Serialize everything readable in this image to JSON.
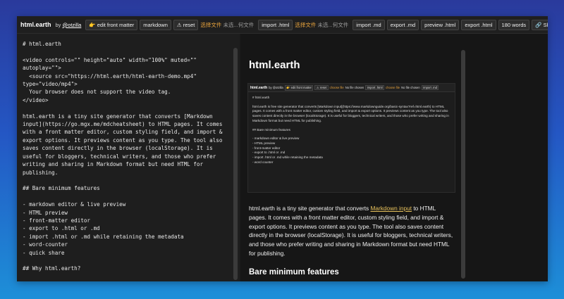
{
  "toolbar": {
    "brand": "html.earth",
    "by_prefix": "by",
    "by_user": "@otzilla",
    "edit_front_matter": "👉 edit front matter",
    "markdown": "markdown",
    "reset": "⚠ reset",
    "file1_btn": "选择文件",
    "file1_status": "未选...何文件",
    "import_html": "import .html",
    "file2_btn": "选择文件",
    "file2_status": "未选...何文件",
    "import_md": "import .md",
    "export_md": "export .md",
    "preview_html": "preview .html",
    "export_html": "export .html",
    "word_count": "180 words",
    "share": "🔗 Share"
  },
  "editor": {
    "content": "# html.earth\n\n<video controls=\"\" height=\"auto\" width=\"100%\" muted=\"\"\nautoplay=\"\">\n  <source src=\"https://html.earth/html-earth-demo.mp4\"\ntype=\"video/mp4\">\n  Your browser does not support the video tag.\n</video>\n\nhtml.earth is a tiny site generator that converts [Markdown\ninput](https://go.mgx.me/mdcheatsheet) to HTML pages. It comes\nwith a front matter editor, custom styling field, and import &\nexport options. It previews content as you type. The tool also\nsaves content directly in the browser (localStorage). It is\nuseful for bloggers, technical writers, and those who prefer\nwriting and sharing in Markdown format but need HTML for\npublishing.\n\n## Bare minimum features\n\n- markdown editor & live preview\n- HTML preview\n- front-matter editor\n- export to .html or .md\n- import .html or .md while retaining the metadata\n- word-counter\n- quick share\n\n## Why html.earth?\n\nThe main philosophy behind html.earth is that «creating simple"
  },
  "preview": {
    "title": "html.earth",
    "screenshot": {
      "toolbar": {
        "brand": "html.earth",
        "by": "by @otzilla",
        "edit": "👉 edit front matter",
        "reset": "⚠ reset",
        "file_btn": "choose file",
        "file_status": "No file chosen",
        "import_html": "import .html",
        "file_btn2": "choose file",
        "file_status2": "No file chosen",
        "import_md": "import .md"
      },
      "heading": "# html.earth",
      "para": "html.earth is free site generator that converts [Markdown input](https://www.markdownguide.org/basic-syntax?ref=html.earth) to HTML pages. It comes with a front matter editor, custom styling field, and import & export options. It previews content as you type. The tool also saves content directly in the browser (localStorage). It is useful for bloggers, technical writers, and those who prefer writing and sharing in Markdown format but need HTML for publishing.",
      "section": "## Bare minimum features",
      "items": [
        "- markdown editor & live preview",
        "- HTML preview",
        "- front-matter editor",
        "- export to .html or .md",
        "- import .html or .md while retaining the metadata",
        "- word counter"
      ]
    },
    "para_before": "html.earth is a tiny site generator that converts ",
    "para_link": "Markdown input",
    "para_after": " to HTML pages. It comes with a front matter editor, custom styling field, and import & export options. It previews content as you type. The tool also saves content directly in the browser (localStorage). It is useful for bloggers, technical writers, and those who prefer writing and sharing in Markdown format but need HTML for publishing.",
    "h2": "Bare minimum features"
  },
  "colors": {
    "accent": "#e6a23c",
    "link": "#e6c15c",
    "background": "#1b1b1b"
  }
}
